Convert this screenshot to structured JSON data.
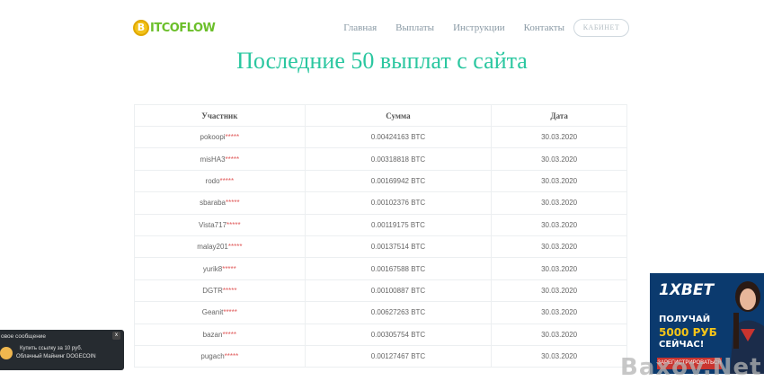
{
  "header": {
    "logo_text": "ITCOFLOW",
    "logo_letter": "B",
    "nav": [
      "Главная",
      "Выплаты",
      "Инструкции",
      "Контакты"
    ],
    "cabinet_label": "КАБИНЕТ"
  },
  "page": {
    "title": "Последние 50 выплат с сайта"
  },
  "table": {
    "headers": [
      "Участник",
      "Сумма",
      "Дата"
    ],
    "rows": [
      {
        "user": "pokoopi",
        "stars": "*****",
        "amount": "0.00424163 BTC",
        "date": "30.03.2020"
      },
      {
        "user": "misHA3",
        "stars": "*****",
        "amount": "0.00318818 BTC",
        "date": "30.03.2020"
      },
      {
        "user": "rodo",
        "stars": "*****",
        "amount": "0.00169942 BTC",
        "date": "30.03.2020"
      },
      {
        "user": "sbaraba",
        "stars": "*****",
        "amount": "0.00102376 BTC",
        "date": "30.03.2020"
      },
      {
        "user": "Vista717",
        "stars": "*****",
        "amount": "0.00119175 BTC",
        "date": "30.03.2020"
      },
      {
        "user": "malay201",
        "stars": "*****",
        "amount": "0.00137514 BTC",
        "date": "30.03.2020"
      },
      {
        "user": "yurik8",
        "stars": "*****",
        "amount": "0.00167588 BTC",
        "date": "30.03.2020"
      },
      {
        "user": "DGTR",
        "stars": "*****",
        "amount": "0.00100887 BTC",
        "date": "30.03.2020"
      },
      {
        "user": "Geanit",
        "stars": "*****",
        "amount": "0.00627263 BTC",
        "date": "30.03.2020"
      },
      {
        "user": "bazan",
        "stars": "*****",
        "amount": "0.00305754 BTC",
        "date": "30.03.2020"
      },
      {
        "user": "pugach",
        "stars": "*****",
        "amount": "0.00127467 BTC",
        "date": "30.03.2020"
      }
    ]
  },
  "notification": {
    "title": "овое сообщение",
    "close": "x",
    "line1": "Купить ссылку за 10 руб.",
    "line2": "Облачный Майнинг DOGECOIN"
  },
  "ad": {
    "brand": "1XBET",
    "line1": "ПОЛУЧАЙ",
    "line2": "5000 РУБ",
    "line3": "СЕЙЧАС!",
    "button": "ЗАРЕГИСТРИРОВАТЬСЯ"
  },
  "watermark": "Baxov.Net",
  "colors": {
    "accent": "#2bc7a0",
    "stars": "#e05a5a",
    "nav": "#8a9aa5",
    "ad_bg": "#0b3a6e"
  }
}
